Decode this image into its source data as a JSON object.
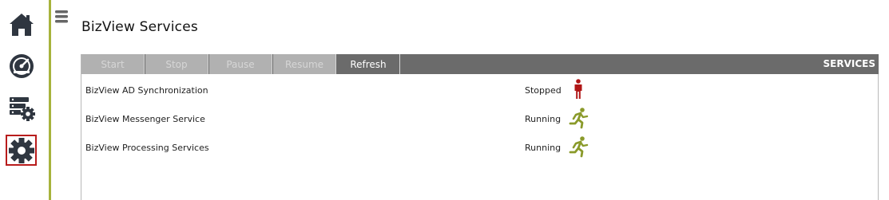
{
  "sidebar": {
    "items": [
      {
        "name": "home",
        "icon": "home-icon"
      },
      {
        "name": "dashboard",
        "icon": "speedometer-icon"
      },
      {
        "name": "server-settings",
        "icon": "server-gear-icon"
      },
      {
        "name": "settings",
        "icon": "gear-icon",
        "selected": true
      }
    ],
    "accent_color": "#a7b33c",
    "selected_border_color": "#b81c1c"
  },
  "menu_toggle_icon": "hamburger-icon",
  "page": {
    "title": "BizView Services"
  },
  "toolbar": {
    "buttons": [
      {
        "label": "Start",
        "enabled": false
      },
      {
        "label": "Stop",
        "enabled": false
      },
      {
        "label": "Pause",
        "enabled": false
      },
      {
        "label": "Resume",
        "enabled": false
      },
      {
        "label": "Refresh",
        "enabled": true
      }
    ],
    "section_title": "SERVICES"
  },
  "services": [
    {
      "name": "BizView AD Synchronization",
      "status": "Stopped",
      "icon": "standing-person-icon",
      "icon_color": "#b01616"
    },
    {
      "name": "BizView Messenger Service",
      "status": "Running",
      "icon": "running-person-icon",
      "icon_color": "#8a9a2a"
    },
    {
      "name": "BizView Processing Services",
      "status": "Running",
      "icon": "running-person-icon",
      "icon_color": "#8a9a2a"
    }
  ]
}
